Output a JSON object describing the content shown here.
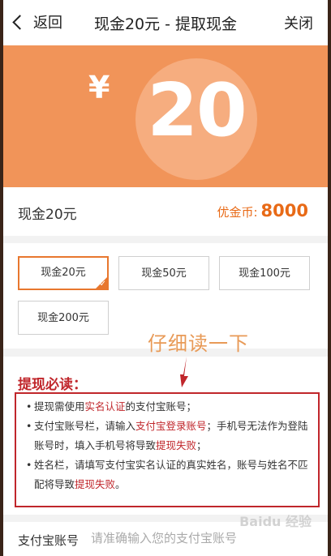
{
  "header": {
    "back_label": "返回",
    "title": "现金20元 - 提取现金",
    "close_label": "关闭"
  },
  "banner": {
    "currency_symbol": "¥",
    "amount": "20"
  },
  "info": {
    "cash_name": "现金20元",
    "coins_label": "优金币:",
    "coins_value": "8000"
  },
  "options": [
    {
      "label": "现金20元",
      "selected": true
    },
    {
      "label": "现金50元",
      "selected": false
    },
    {
      "label": "现金100元",
      "selected": false
    },
    {
      "label": "现金200元",
      "selected": false
    }
  ],
  "annotation": "仔细读一下",
  "notice": {
    "title": "提现必读：",
    "rule1_a": "提现需使用",
    "rule1_hl": "实名认证",
    "rule1_b": "的支付宝账号；",
    "rule2_a": "支付宝账号栏，请输入",
    "rule2_hl": "支付宝登录账号",
    "rule2_b": "；手机号无法作为登陆账号时，填入手机号将导致",
    "rule2_hl2": "提现失败",
    "rule2_c": "；",
    "rule3_a": "姓名栏，请填写支付宝实名认证的真实姓名，账号与姓名不匹配将导致",
    "rule3_hl": "提现失败",
    "rule3_b": "。"
  },
  "alipay": {
    "label": "支付宝账号",
    "placeholder": "请准确输入您的支付宝账号"
  },
  "watermark": "Baidu 经验",
  "colors": {
    "accent": "#e8772e",
    "banner": "#f19459",
    "warning": "#c0262b"
  }
}
